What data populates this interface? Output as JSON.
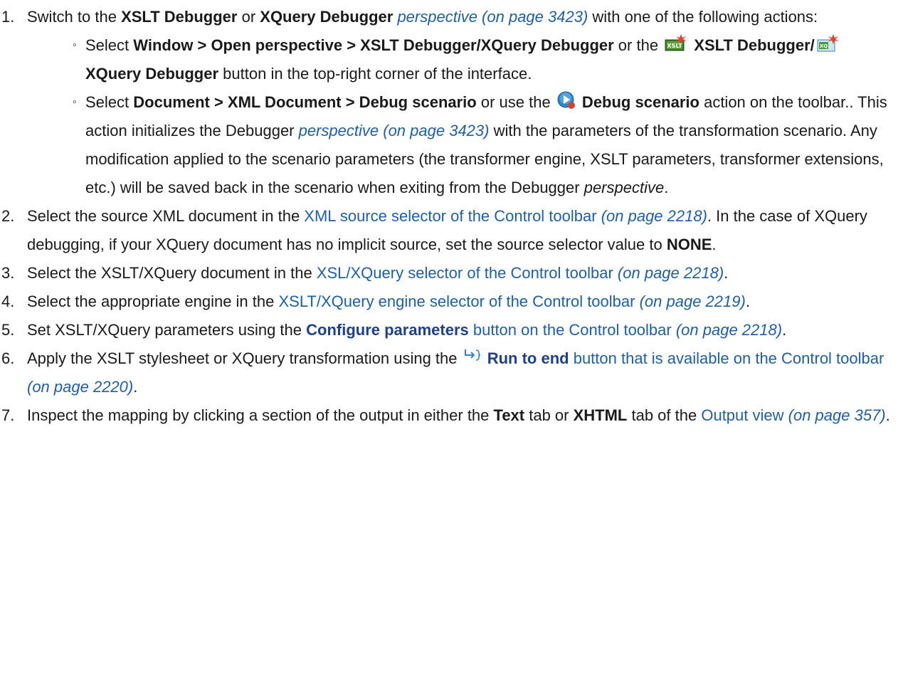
{
  "steps": [
    {
      "num": "1.",
      "t1": "Switch to the ",
      "b1": "XSLT Debugger",
      "t2": " or ",
      "b2": "XQuery Debugger",
      "t3": " ",
      "link1": "perspective (on page 3423)",
      "t4": " with one of the following actions:",
      "subs": [
        {
          "t1": "Select ",
          "b1": "Window > Open perspective > XSLT Debugger/XQuery Debugger",
          "t2": " or the ",
          "icon1": "xslt-debugger-icon",
          "icon1_label": "XSLT",
          "b2": " XSLT Debugger/",
          "icon2": "xquery-debugger-icon",
          "icon2_label": "XQ",
          "b3": " XQuery Debugger",
          "t3": " button in the top-right corner of the interface."
        },
        {
          "t1": "Select ",
          "b1": "Document > XML Document > Debug scenario",
          "t2": " or use the ",
          "icon1": "debug-scenario-icon",
          "b2": " Debug scenario",
          "t3": " action on the toolbar.. This action initializes the Debugger ",
          "link1": "perspective (on page 3423)",
          "t4": " with the parameters of the transformation scenario. Any modification applied to the scenario parameters (the transformer engine, XSLT parameters, transformer extensions, etc.) will be saved back in the scenario when exiting from the Debugger ",
          "it1": "perspective",
          "t5": "."
        }
      ]
    },
    {
      "num": "2.",
      "t1": "Select the source XML document in the ",
      "link1": "XML source selector of the Control toolbar",
      "link1i": " (on page 2218)",
      "t2": ". In the case of XQuery debugging, if your XQuery document has no implicit source, set the source selector value to ",
      "b1": "NONE",
      "t3": "."
    },
    {
      "num": "3.",
      "t1": "Select the XSLT/XQuery document in the ",
      "link1": "XSL/XQuery selector of the Control toolbar",
      "link1i": " (on page 2218)",
      "t2": "."
    },
    {
      "num": "4.",
      "t1": "Select the appropriate engine in the ",
      "link1": "XSLT/XQuery engine selector of the Control toolbar",
      "link1i": " (on page 2219)",
      "t2": "."
    },
    {
      "num": "5.",
      "t1": "Set XSLT/XQuery parameters using the ",
      "linkb": "Configure parameters",
      "link1": " button on the Control toolbar",
      "link1i": " (on page 2218)",
      "t2": "."
    },
    {
      "num": "6.",
      "t1": "Apply the XSLT stylesheet or XQuery transformation using the ",
      "icon1": "run-to-end-icon",
      "linkb": " Run to end",
      "link1": " button that is available on the Control toolbar",
      "link1i": " (on page 2220)",
      "t2": "."
    },
    {
      "num": "7.",
      "t1": "Inspect the mapping by clicking a section of the output in either the ",
      "b1": "Text",
      "t2": " tab or ",
      "b2": "XHTML",
      "t3": " tab of the ",
      "link1": "Output view",
      "link1i": " (on page 357)",
      "t4": "."
    }
  ],
  "colors": {
    "text": "#1a1a1a",
    "link": "#1f5fa8",
    "link_bold": "#1f3f8f"
  }
}
